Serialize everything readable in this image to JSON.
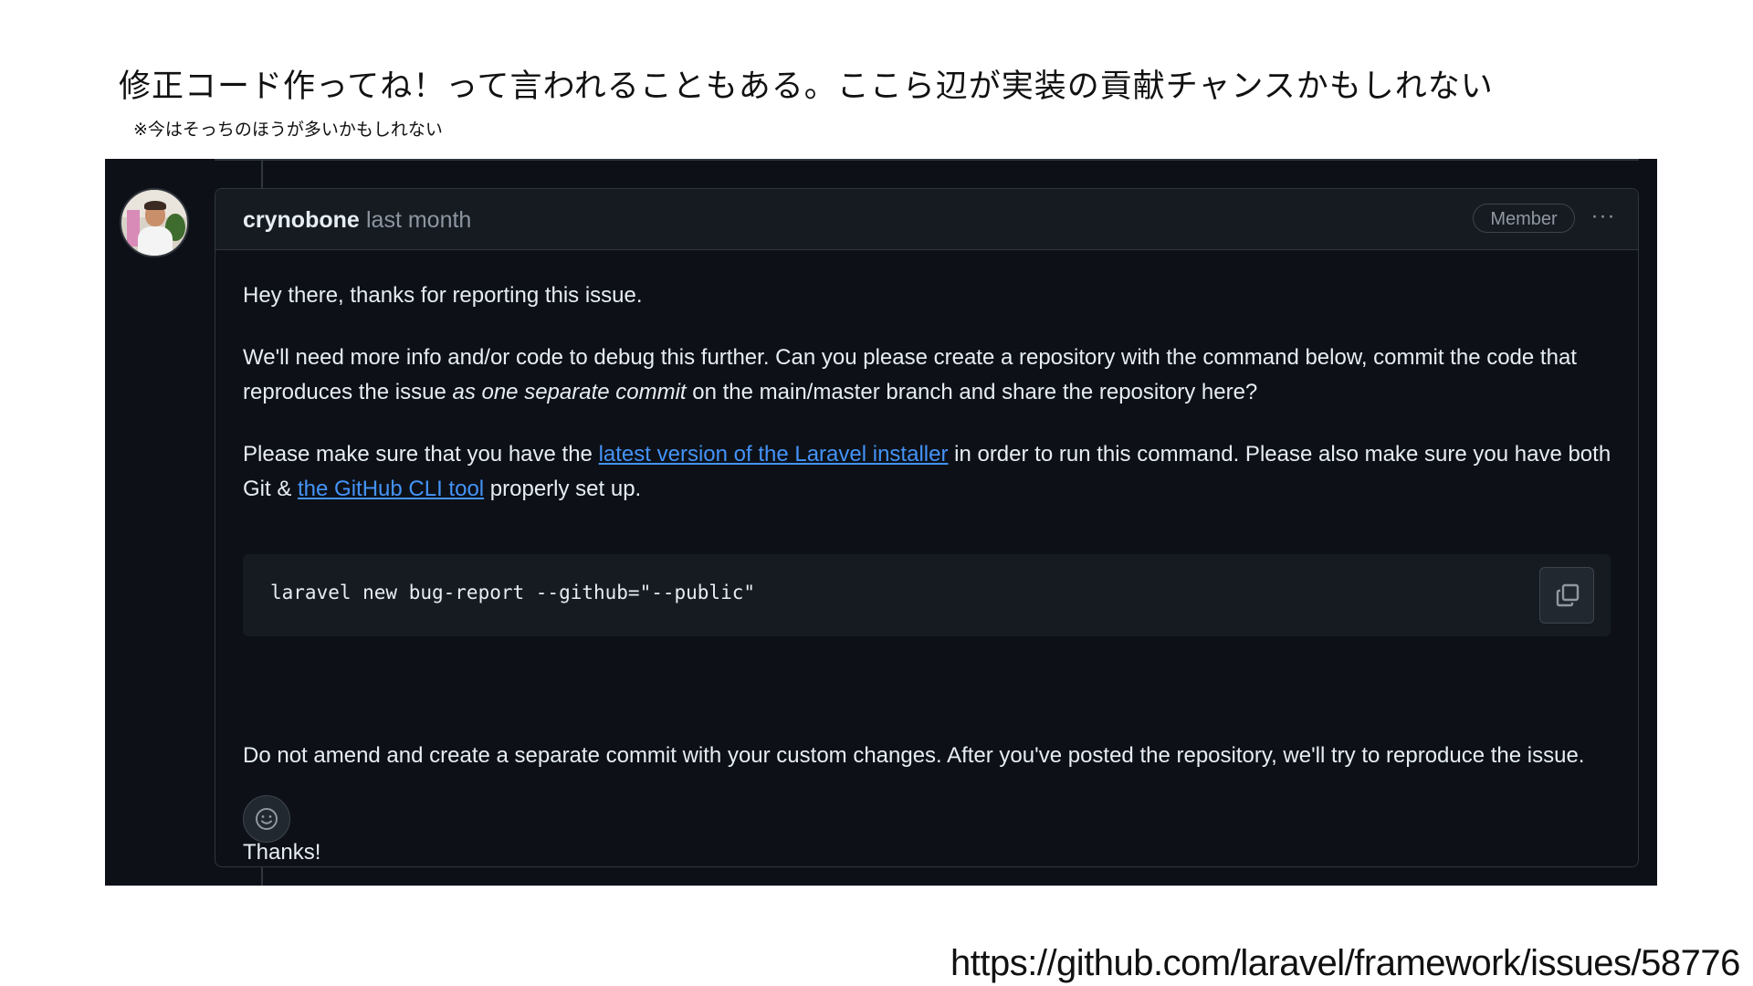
{
  "slide": {
    "headline": "修正コード作ってね！って言われることもある。ここら辺が実装の貢献チャンスかもしれない",
    "subnote": "※今はそっちのほうが多いかもしれない",
    "source_url": "https://github.com/laravel/framework/issues/58776"
  },
  "comment": {
    "author": "crynobone",
    "time": "last month",
    "badge": "Member",
    "more_menu": "···",
    "p1": "Hey there, thanks for reporting this issue.",
    "p2_a": "We'll need more info and/or code to debug this further. Can you please create a repository with the command below, commit the code that reproduces the issue ",
    "p2_em": "as one separate commit",
    "p2_b": " on the main/master branch and share the repository here?",
    "p3_a": "Please make sure that you have the ",
    "p3_link1": "latest version of the Laravel installer",
    "p3_b": " in order to run this command. Please also make sure you have both Git & ",
    "p3_link2": "the GitHub CLI tool",
    "p3_c": " properly set up.",
    "code": "laravel new bug-report --github=\"--public\"",
    "p5": "Do not amend and create a separate commit with your custom changes. After you've posted the repository, we'll try to reproduce the issue.",
    "p6": "Thanks!"
  },
  "icons": {
    "copy": "copy-icon",
    "reaction": "smiley-icon",
    "more": "kebab-icon"
  },
  "colors": {
    "background": "#0d1117",
    "link": "#4493f8",
    "text": "#e6edf3",
    "muted": "#8d96a0",
    "border": "#30363d"
  }
}
